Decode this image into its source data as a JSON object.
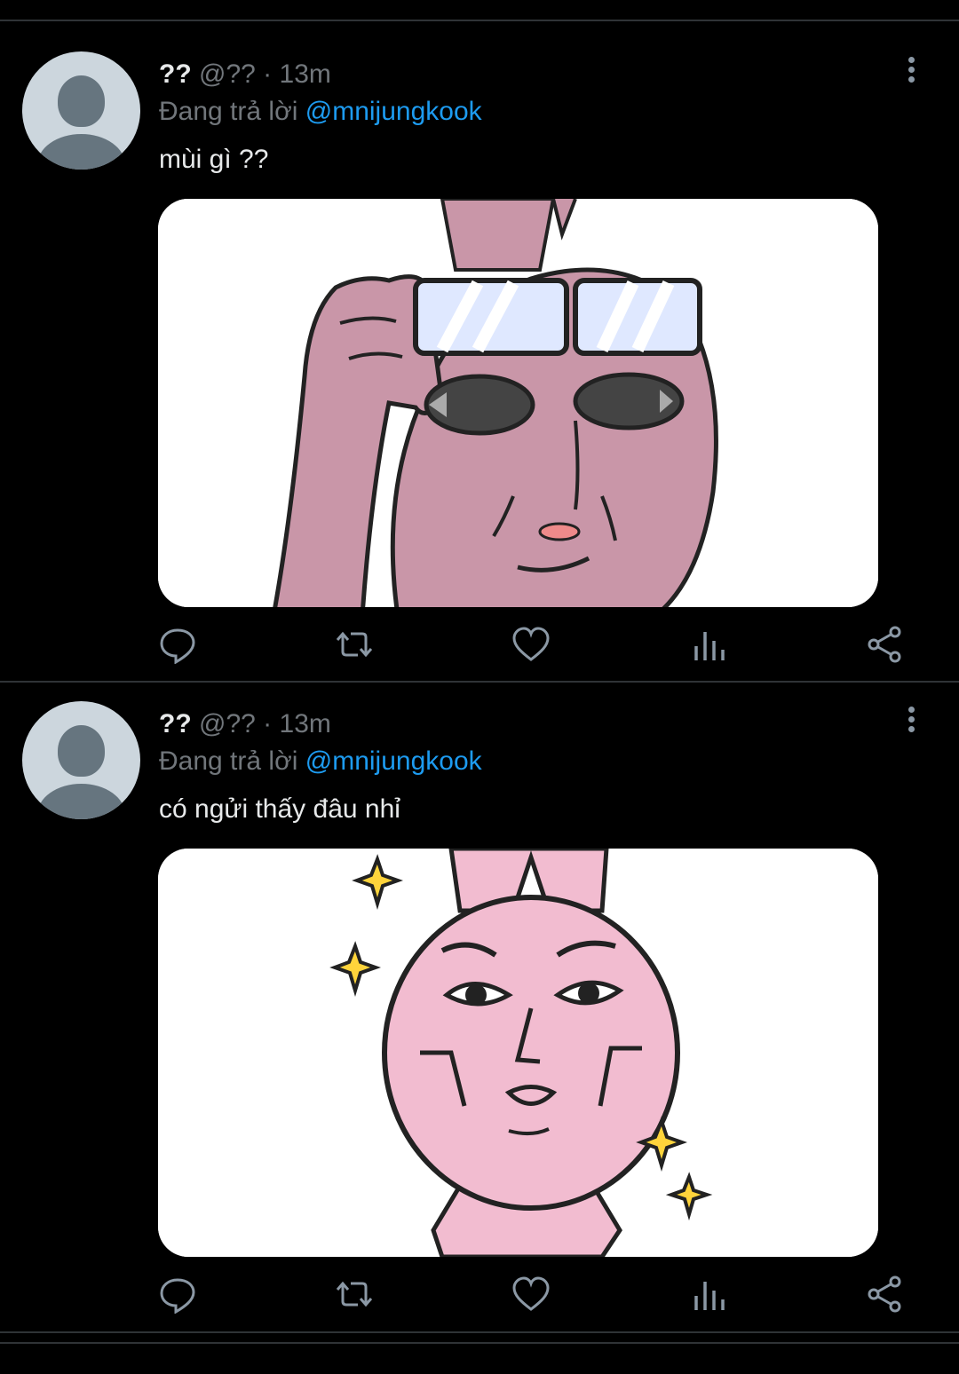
{
  "tweets": [
    {
      "name": "??",
      "handle": "@??",
      "separator": "·",
      "time": "13m",
      "reply_prefix": "Đang trả lời",
      "reply_handle": "@mnijungkook",
      "text": "mùi gì ??",
      "media_description_icon": "pink-rabbit-glasses-sticker",
      "actions": [
        "reply-icon",
        "retweet-icon",
        "like-icon",
        "analytics-icon",
        "share-icon"
      ]
    },
    {
      "name": "??",
      "handle": "@??",
      "separator": "·",
      "time": "13m",
      "reply_prefix": "Đang trả lời",
      "reply_handle": "@mnijungkook",
      "text": "có ngửi thấy đâu nhỉ",
      "media_description_icon": "pink-rabbit-sparkles-sticker",
      "actions": [
        "reply-icon",
        "retweet-icon",
        "like-icon",
        "analytics-icon",
        "share-icon"
      ]
    }
  ],
  "colors": {
    "background": "#000000",
    "divider": "#2f3336",
    "text_primary": "#e7e9ea",
    "text_secondary": "#71767b",
    "link": "#1d9bf0",
    "icon": "#8b98a5"
  }
}
